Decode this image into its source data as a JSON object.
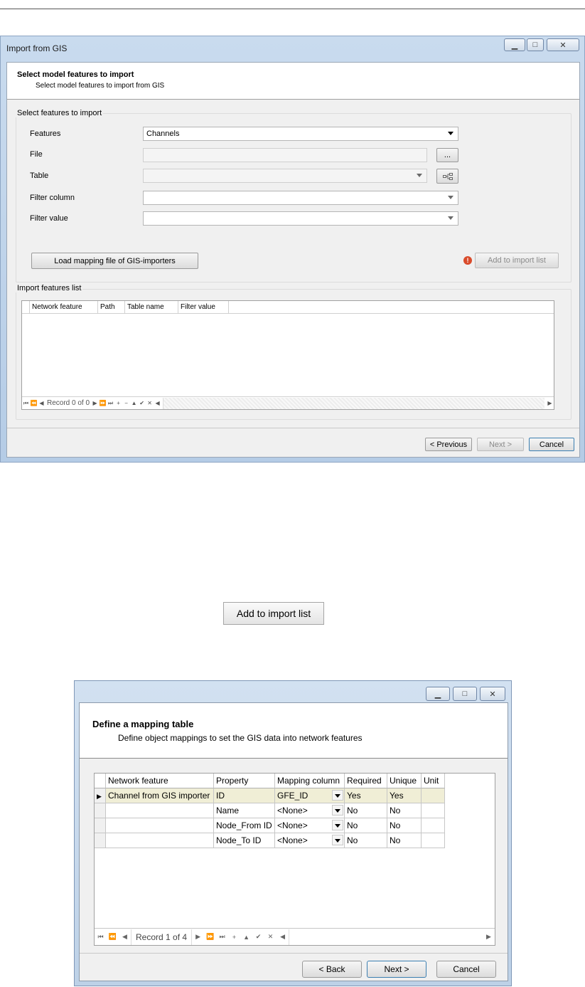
{
  "window1": {
    "title": "Import from GIS",
    "header": {
      "title": "Select model features to import",
      "subtitle": "Select model features to import from GIS"
    },
    "select_group": {
      "title": "Select features to import",
      "features_label": "Features",
      "features_value": "Channels",
      "file_label": "File",
      "file_value": "",
      "browse_label": "...",
      "table_label": "Table",
      "table_value": "",
      "filter_column_label": "Filter column",
      "filter_column_value": "",
      "filter_value_label": "Filter value",
      "filter_value_value": "",
      "load_mapping_label": "Load mapping file of GIS-importers",
      "add_to_import_label": "Add to import list"
    },
    "import_group": {
      "title": "Import features list",
      "columns": [
        "Network feature",
        "Path",
        "Table name",
        "Filter value"
      ],
      "record_text": "Record 0 of 0"
    },
    "footer": {
      "previous_label": "< Previous",
      "next_label": "Next >",
      "cancel_label": "Cancel"
    }
  },
  "standalone_button": {
    "label": "Add to import list"
  },
  "window2": {
    "header": {
      "title": "Define a mapping table",
      "subtitle": "Define object mappings to set the GIS data into network features"
    },
    "columns": [
      "Network feature",
      "Property",
      "Mapping column",
      "Required",
      "Unique",
      "Unit"
    ],
    "rows": [
      {
        "network_feature": "Channel from GIS importer",
        "property": "ID",
        "mapping_column": "GFE_ID",
        "required": "Yes",
        "unique": "Yes",
        "unit": ""
      },
      {
        "network_feature": "",
        "property": "Name",
        "mapping_column": "<None>",
        "required": "No",
        "unique": "No",
        "unit": ""
      },
      {
        "network_feature": "",
        "property": "Node_From ID",
        "mapping_column": "<None>",
        "required": "No",
        "unique": "No",
        "unit": ""
      },
      {
        "network_feature": "",
        "property": "Node_To ID",
        "mapping_column": "<None>",
        "required": "No",
        "unique": "No",
        "unit": ""
      }
    ],
    "record_text": "Record 1 of 4",
    "footer": {
      "back_label": "< Back",
      "next_label": "Next >",
      "cancel_label": "Cancel"
    }
  }
}
